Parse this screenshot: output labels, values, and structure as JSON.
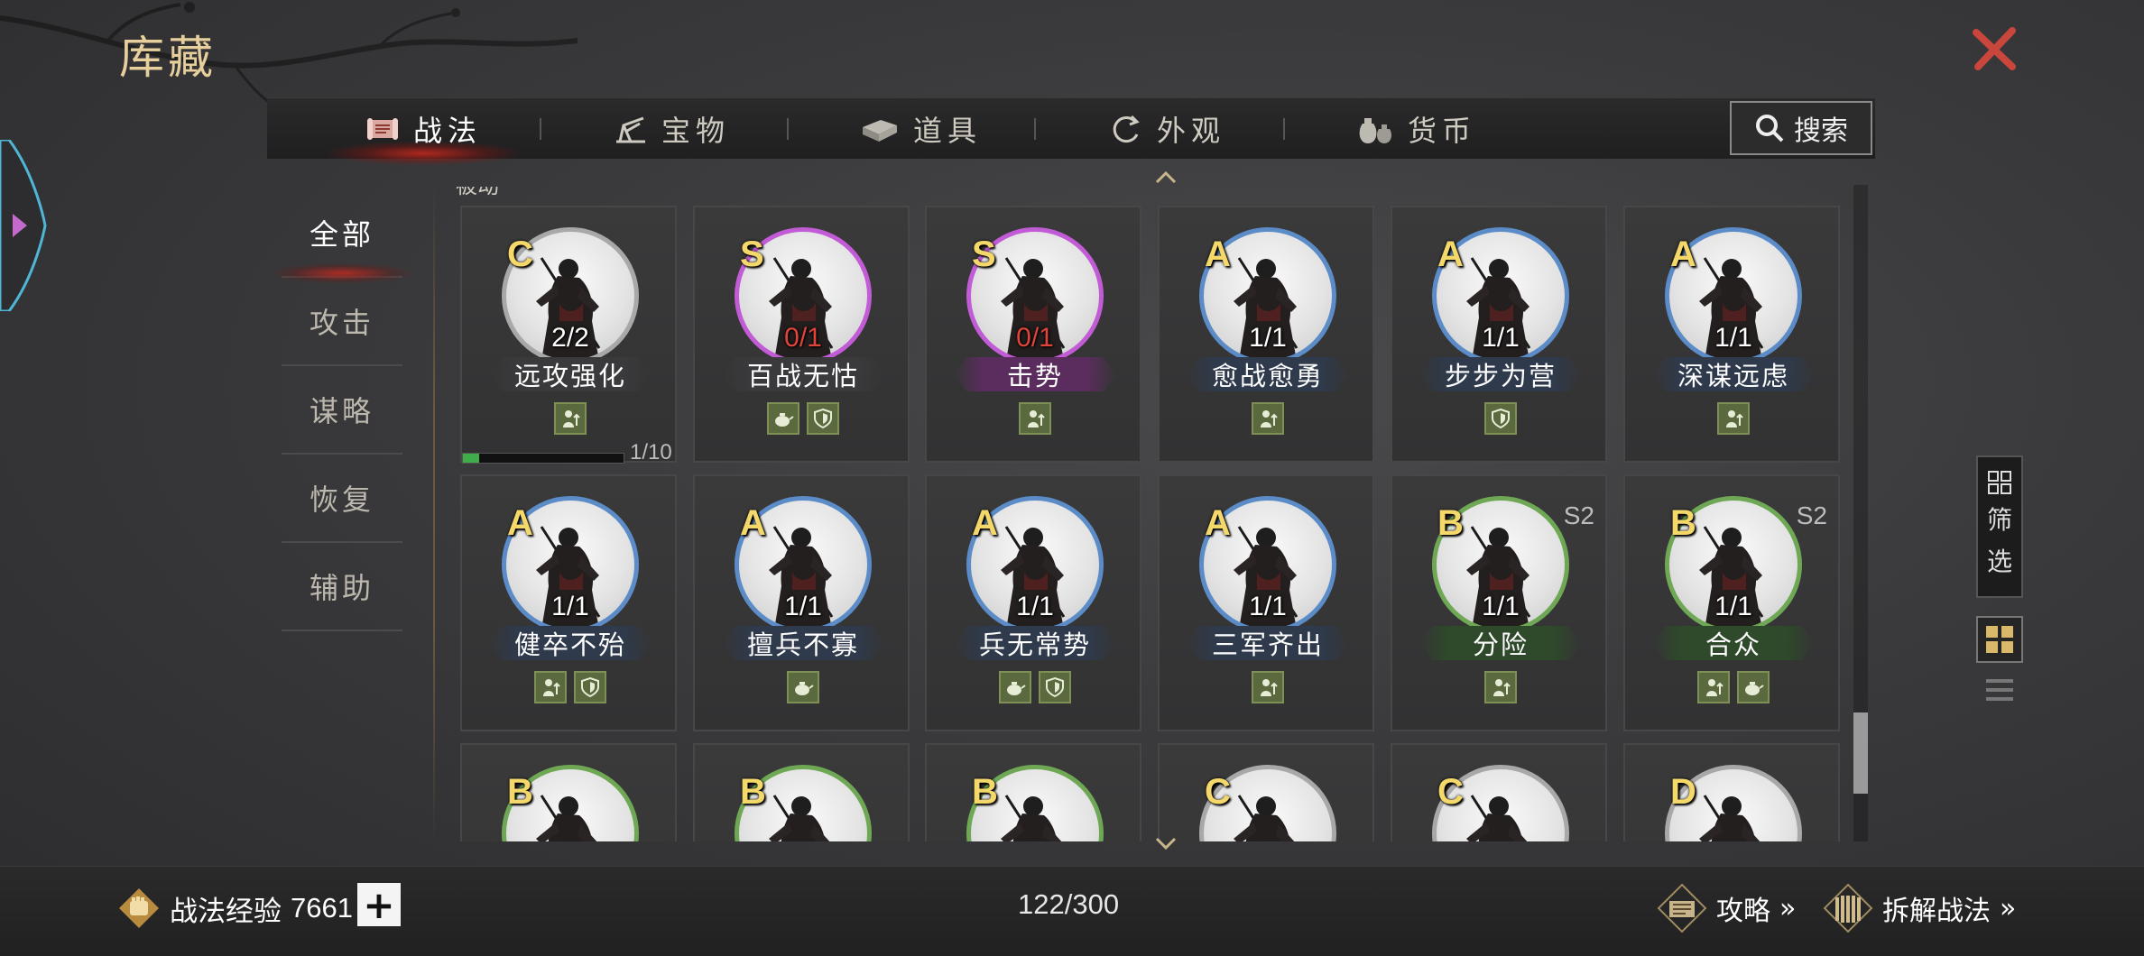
{
  "header": {
    "title": "库藏"
  },
  "tabs": [
    {
      "label": "战法",
      "icon": "scroll-icon",
      "active": true
    },
    {
      "label": "宝物",
      "icon": "treasure-icon",
      "active": false
    },
    {
      "label": "道具",
      "icon": "item-icon",
      "active": false
    },
    {
      "label": "外观",
      "icon": "appearance-icon",
      "active": false
    },
    {
      "label": "货币",
      "icon": "coin-bag-icon",
      "active": false
    }
  ],
  "search": {
    "label": "搜索"
  },
  "sidebar": {
    "items": [
      {
        "label": "全部",
        "active": true
      },
      {
        "label": "攻击",
        "active": false
      },
      {
        "label": "谋略",
        "active": false
      },
      {
        "label": "恢复",
        "active": false
      },
      {
        "label": "辅助",
        "active": false
      }
    ]
  },
  "section_cut_label": "被动",
  "cards": [
    {
      "grade": "C",
      "count": "2/2",
      "count_red": false,
      "name": "远攻强化",
      "season": "",
      "color": "#a8a8a8",
      "bar": "#3a3a3c",
      "icons": [
        "attack-icon"
      ],
      "progress": {
        "value": 1,
        "max": 10,
        "text": "1/10"
      }
    },
    {
      "grade": "S",
      "count": "0/1",
      "count_red": true,
      "name": "百战无怙",
      "season": "",
      "color": "#c25bd6",
      "bar": "#3a3a3c",
      "icons": [
        "teapot-icon",
        "shield-icon"
      ]
    },
    {
      "grade": "S",
      "count": "0/1",
      "count_red": true,
      "name": "击势",
      "season": "",
      "color": "#c25bd6",
      "bar": "#5a2d5e",
      "icons": [
        "attack-icon"
      ]
    },
    {
      "grade": "A",
      "count": "1/1",
      "count_red": false,
      "name": "愈战愈勇",
      "season": "",
      "color": "#5b8cc8",
      "bar": "#2f3a4c",
      "icons": [
        "attack-icon"
      ]
    },
    {
      "grade": "A",
      "count": "1/1",
      "count_red": false,
      "name": "步步为营",
      "season": "",
      "color": "#5b8cc8",
      "bar": "#2f3a4c",
      "icons": [
        "shield-icon"
      ]
    },
    {
      "grade": "A",
      "count": "1/1",
      "count_red": false,
      "name": "深谋远虑",
      "season": "",
      "color": "#5b8cc8",
      "bar": "#2f3a4c",
      "icons": [
        "attack-icon"
      ]
    },
    {
      "grade": "A",
      "count": "1/1",
      "count_red": false,
      "name": "健卒不殆",
      "season": "",
      "color": "#5b8cc8",
      "bar": "#2f3a4c",
      "icons": [
        "attack-icon",
        "shield-icon"
      ]
    },
    {
      "grade": "A",
      "count": "1/1",
      "count_red": false,
      "name": "擅兵不寡",
      "season": "",
      "color": "#5b8cc8",
      "bar": "#2f3a4c",
      "icons": [
        "teapot-icon"
      ]
    },
    {
      "grade": "A",
      "count": "1/1",
      "count_red": false,
      "name": "兵无常势",
      "season": "",
      "color": "#5b8cc8",
      "bar": "#2f3a4c",
      "icons": [
        "teapot-icon",
        "shield-icon"
      ]
    },
    {
      "grade": "A",
      "count": "1/1",
      "count_red": false,
      "name": "三军齐出",
      "season": "",
      "color": "#5b8cc8",
      "bar": "#2f3a4c",
      "icons": [
        "attack-icon"
      ]
    },
    {
      "grade": "B",
      "count": "1/1",
      "count_red": false,
      "name": "分险",
      "season": "S2",
      "color": "#6fa855",
      "bar": "#2e4a2a",
      "icons": [
        "attack-icon"
      ]
    },
    {
      "grade": "B",
      "count": "1/1",
      "count_red": false,
      "name": "合众",
      "season": "S2",
      "color": "#6fa855",
      "bar": "#2e4a2a",
      "icons": [
        "attack-icon",
        "teapot-icon"
      ]
    },
    {
      "grade": "B",
      "count": "",
      "count_red": false,
      "name": "",
      "season": "",
      "color": "#6fa855",
      "bar": "#2e4a2a",
      "icons": []
    },
    {
      "grade": "B",
      "count": "",
      "count_red": false,
      "name": "",
      "season": "",
      "color": "#6fa855",
      "bar": "#2e4a2a",
      "icons": []
    },
    {
      "grade": "B",
      "count": "",
      "count_red": false,
      "name": "",
      "season": "",
      "color": "#6fa855",
      "bar": "#2e4a2a",
      "icons": []
    },
    {
      "grade": "C",
      "count": "",
      "count_red": false,
      "name": "",
      "season": "",
      "color": "#a8a8a8",
      "bar": "#3a3a3c",
      "icons": []
    },
    {
      "grade": "C",
      "count": "",
      "count_red": false,
      "name": "",
      "season": "",
      "color": "#a8a8a8",
      "bar": "#3a3a3c",
      "icons": []
    },
    {
      "grade": "D",
      "count": "",
      "count_red": false,
      "name": "",
      "season": "",
      "color": "#a8a8a8",
      "bar": "#3a3a3c",
      "icons": []
    }
  ],
  "filter": {
    "label_1": "筛",
    "label_2": "选"
  },
  "footer": {
    "exp_label": "战法经验",
    "exp_value": "7661",
    "plus": "+",
    "capacity": "122/300",
    "guide_label": "攻略",
    "dismantle_label": "拆解战法",
    "chevrons": "»"
  }
}
